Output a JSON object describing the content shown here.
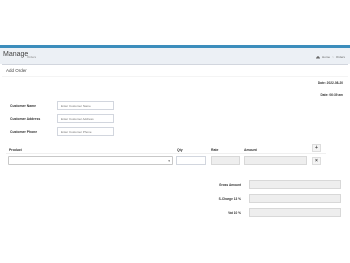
{
  "header": {
    "title": "Manage",
    "subtitle": "Orders",
    "breadcrumb": [
      "Home",
      "Orders"
    ]
  },
  "box": {
    "title": "Add Order",
    "date_label": "Date: 2022-08-20",
    "time_label": "Date: 06:39 am"
  },
  "customer": {
    "name_label": "Customer Name",
    "name_placeholder": "Enter Customer Name",
    "address_label": "Customer Address",
    "address_placeholder": "Enter Customer Address",
    "phone_label": "Customer Phone",
    "phone_placeholder": "Enter Customer Phone"
  },
  "products_table": {
    "headers": [
      "Product",
      "Qty",
      "Rate",
      "Amount"
    ],
    "add_button": "+",
    "remove_button": "×"
  },
  "summary": {
    "gross_amount_label": "Gross Amount",
    "s_charge_label": "S-Charge 13 %",
    "vat_label": "Vat 10 %"
  },
  "colors": {
    "accent": "#3c8dbc",
    "header_bg": "#ecf0f5",
    "readonly_input": "#eeeeee"
  },
  "icons": {
    "home": "home-icon",
    "select_arrow": "chevron-down-icon"
  }
}
